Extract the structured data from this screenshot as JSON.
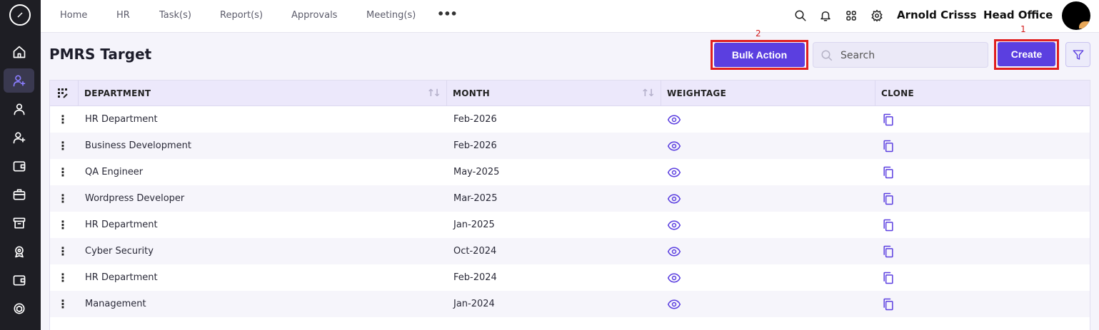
{
  "nav": {
    "items": [
      "Home",
      "HR",
      "Task(s)",
      "Report(s)",
      "Approvals",
      "Meeting(s)"
    ],
    "more": "•••"
  },
  "user": {
    "name": "Arnold Crisss",
    "branch": "Head Office"
  },
  "page": {
    "title": "PMRS Target"
  },
  "actions": {
    "bulk_label": "Bulk Action",
    "bulk_marker": "2",
    "create_label": "Create",
    "create_marker": "1",
    "search_placeholder": "Search"
  },
  "table": {
    "columns": [
      "DEPARTMENT",
      "MONTH",
      "WEIGHTAGE",
      "CLONE"
    ],
    "rows": [
      {
        "department": "HR Department",
        "month": "Feb-2026"
      },
      {
        "department": "Business Development",
        "month": "Feb-2026"
      },
      {
        "department": "QA Engineer",
        "month": "May-2025"
      },
      {
        "department": "Wordpress Developer",
        "month": "Mar-2025"
      },
      {
        "department": "HR Department",
        "month": "Jan-2025"
      },
      {
        "department": "Cyber Security",
        "month": "Oct-2024"
      },
      {
        "department": "HR Department",
        "month": "Feb-2024"
      },
      {
        "department": "Management",
        "month": "Jan-2024"
      }
    ]
  },
  "sidebar": {
    "icons": [
      "home-icon",
      "user-plus-icon",
      "user-icon",
      "user-add-icon",
      "wallet-icon",
      "briefcase-icon",
      "archive-icon",
      "award-icon",
      "wallet-alt-icon",
      "box-icon"
    ]
  },
  "colors": {
    "accent": "#5b3fe0",
    "highlight": "#e01f1f",
    "sidebar": "#1e1e24"
  }
}
